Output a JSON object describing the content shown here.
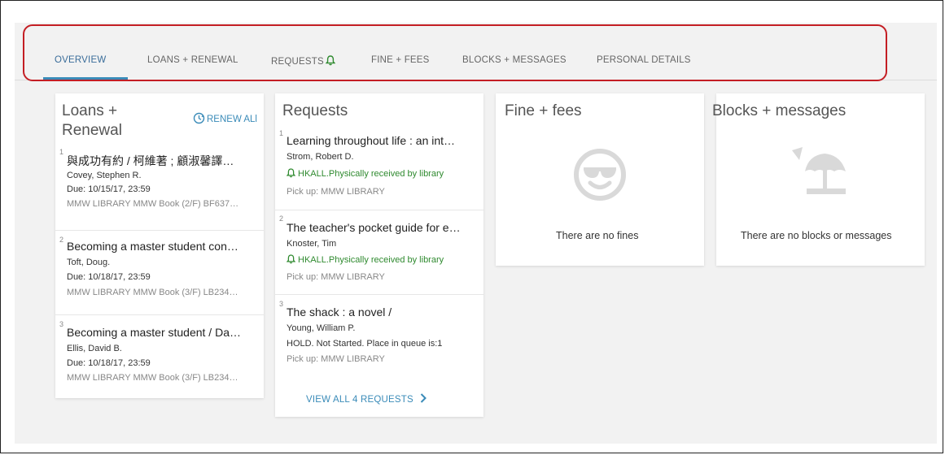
{
  "tabs": [
    {
      "label": "OVERVIEW"
    },
    {
      "label": "LOANS + RENEWAL"
    },
    {
      "label": "REQUESTS"
    },
    {
      "label": "FINE + FEES"
    },
    {
      "label": "BLOCKS + MESSAGES"
    },
    {
      "label": "PERSONAL DETAILS"
    }
  ],
  "accent_color": "#3a8bb8",
  "highlight_color": "#c41e24",
  "loans": {
    "title_line1": "Loans +",
    "title_line2": "Renewal",
    "renew_all_label": "RENEW ALl",
    "items": [
      {
        "num": "1",
        "title": "與成功有約 / 柯維著 ; 顧淑馨譯…",
        "author": "Covey, Stephen R.",
        "due": "Due: 10/15/17, 23:59",
        "location": "MMW LIBRARY MMW Book (2/F) BF637…"
      },
      {
        "num": "2",
        "title": "Becoming a master student con…",
        "author": "Toft, Doug.",
        "due": "Due: 10/18/17, 23:59",
        "location": "MMW LIBRARY MMW Book (3/F) LB234…"
      },
      {
        "num": "3",
        "title": "Becoming a master student / Da…",
        "author": "Ellis, David B.",
        "due": "Due: 10/18/17, 23:59",
        "location": "MMW LIBRARY MMW Book (3/F) LB234…"
      }
    ]
  },
  "requests": {
    "title": "Requests",
    "items": [
      {
        "num": "1",
        "title": "Learning throughout life : an int…",
        "author": "Strom, Robert D.",
        "status": "HKALL.Physically received by library",
        "pickup": "Pick up: MMW LIBRARY"
      },
      {
        "num": "2",
        "title": "The teacher's pocket guide for e…",
        "author": "Knoster, Tim",
        "status": "HKALL.Physically received by library",
        "pickup": "Pick up: MMW LIBRARY"
      },
      {
        "num": "3",
        "title": "The shack : a novel /",
        "author": "Young, William P.",
        "status": "HOLD. Not Started. Place in queue is:1",
        "pickup": "Pick up: MMW LIBRARY"
      }
    ],
    "view_all_label": "VIEW ALL 4 REQUESTS"
  },
  "fines": {
    "title": "Fine + fees",
    "empty_text": "There are no fines",
    "icon": "sunglasses-smiley-icon"
  },
  "blocks": {
    "title": "Blocks + messages",
    "empty_text": "There are no blocks or messages",
    "icon": "beach-umbrella-icon"
  }
}
